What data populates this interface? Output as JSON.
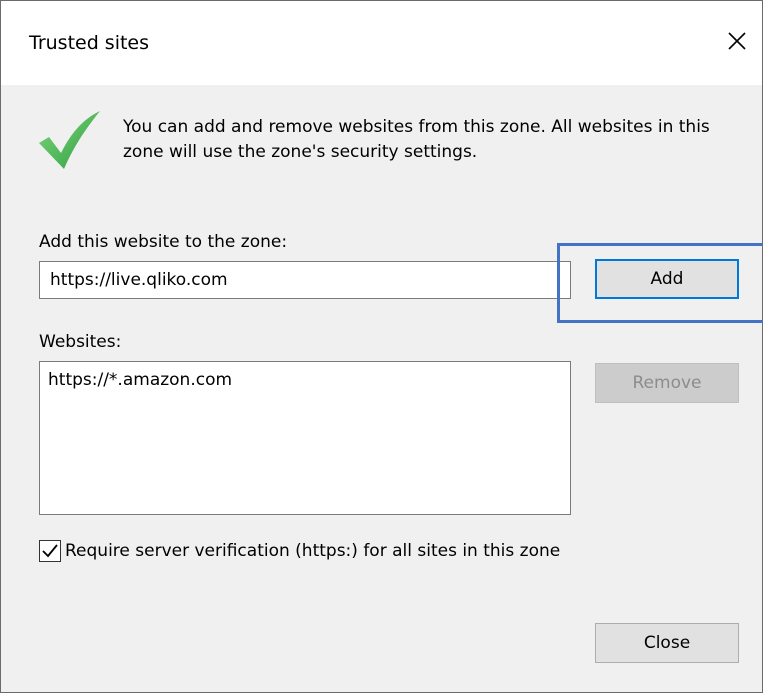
{
  "window": {
    "title": "Trusted sites",
    "close_icon": "close-icon"
  },
  "info": {
    "icon": "checkmark-icon",
    "text": "You can add and remove websites from this zone. All websites in this zone will use the zone's security settings."
  },
  "add_section": {
    "label": "Add this website to the zone:",
    "input_value": "https://live.qliko.com",
    "add_button_label": "Add"
  },
  "websites_section": {
    "label": "Websites:",
    "items": [
      "https://*.amazon.com"
    ],
    "remove_button_label": "Remove"
  },
  "verification": {
    "checked": true,
    "label": "Require server verification (https:) for all sites in this zone"
  },
  "footer": {
    "close_button_label": "Close"
  },
  "colors": {
    "accent": "#0078d7",
    "highlight": "#4472c4",
    "check_green": "#3fb24f",
    "dialog_bg": "#f0f0f0"
  }
}
